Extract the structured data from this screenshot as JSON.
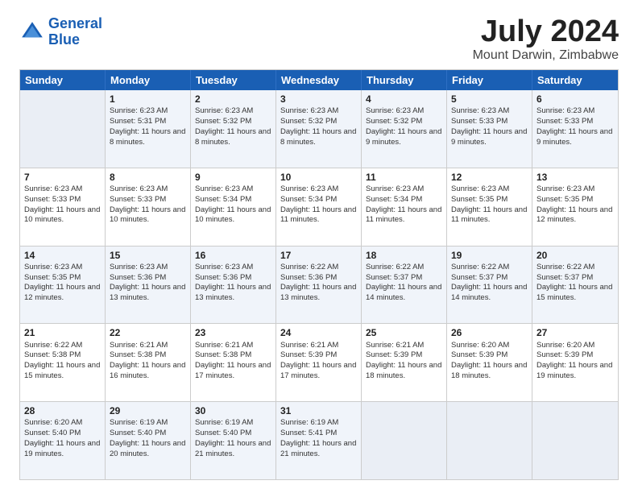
{
  "logo": {
    "line1": "General",
    "line2": "Blue"
  },
  "title": "July 2024",
  "location": "Mount Darwin, Zimbabwe",
  "header_days": [
    "Sunday",
    "Monday",
    "Tuesday",
    "Wednesday",
    "Thursday",
    "Friday",
    "Saturday"
  ],
  "weeks": [
    [
      {
        "day": "",
        "sunrise": "",
        "sunset": "",
        "daylight": ""
      },
      {
        "day": "1",
        "sunrise": "Sunrise: 6:23 AM",
        "sunset": "Sunset: 5:31 PM",
        "daylight": "Daylight: 11 hours and 8 minutes."
      },
      {
        "day": "2",
        "sunrise": "Sunrise: 6:23 AM",
        "sunset": "Sunset: 5:32 PM",
        "daylight": "Daylight: 11 hours and 8 minutes."
      },
      {
        "day": "3",
        "sunrise": "Sunrise: 6:23 AM",
        "sunset": "Sunset: 5:32 PM",
        "daylight": "Daylight: 11 hours and 8 minutes."
      },
      {
        "day": "4",
        "sunrise": "Sunrise: 6:23 AM",
        "sunset": "Sunset: 5:32 PM",
        "daylight": "Daylight: 11 hours and 9 minutes."
      },
      {
        "day": "5",
        "sunrise": "Sunrise: 6:23 AM",
        "sunset": "Sunset: 5:33 PM",
        "daylight": "Daylight: 11 hours and 9 minutes."
      },
      {
        "day": "6",
        "sunrise": "Sunrise: 6:23 AM",
        "sunset": "Sunset: 5:33 PM",
        "daylight": "Daylight: 11 hours and 9 minutes."
      }
    ],
    [
      {
        "day": "7",
        "sunrise": "Sunrise: 6:23 AM",
        "sunset": "Sunset: 5:33 PM",
        "daylight": "Daylight: 11 hours and 10 minutes."
      },
      {
        "day": "8",
        "sunrise": "Sunrise: 6:23 AM",
        "sunset": "Sunset: 5:33 PM",
        "daylight": "Daylight: 11 hours and 10 minutes."
      },
      {
        "day": "9",
        "sunrise": "Sunrise: 6:23 AM",
        "sunset": "Sunset: 5:34 PM",
        "daylight": "Daylight: 11 hours and 10 minutes."
      },
      {
        "day": "10",
        "sunrise": "Sunrise: 6:23 AM",
        "sunset": "Sunset: 5:34 PM",
        "daylight": "Daylight: 11 hours and 11 minutes."
      },
      {
        "day": "11",
        "sunrise": "Sunrise: 6:23 AM",
        "sunset": "Sunset: 5:34 PM",
        "daylight": "Daylight: 11 hours and 11 minutes."
      },
      {
        "day": "12",
        "sunrise": "Sunrise: 6:23 AM",
        "sunset": "Sunset: 5:35 PM",
        "daylight": "Daylight: 11 hours and 11 minutes."
      },
      {
        "day": "13",
        "sunrise": "Sunrise: 6:23 AM",
        "sunset": "Sunset: 5:35 PM",
        "daylight": "Daylight: 11 hours and 12 minutes."
      }
    ],
    [
      {
        "day": "14",
        "sunrise": "Sunrise: 6:23 AM",
        "sunset": "Sunset: 5:35 PM",
        "daylight": "Daylight: 11 hours and 12 minutes."
      },
      {
        "day": "15",
        "sunrise": "Sunrise: 6:23 AM",
        "sunset": "Sunset: 5:36 PM",
        "daylight": "Daylight: 11 hours and 13 minutes."
      },
      {
        "day": "16",
        "sunrise": "Sunrise: 6:23 AM",
        "sunset": "Sunset: 5:36 PM",
        "daylight": "Daylight: 11 hours and 13 minutes."
      },
      {
        "day": "17",
        "sunrise": "Sunrise: 6:22 AM",
        "sunset": "Sunset: 5:36 PM",
        "daylight": "Daylight: 11 hours and 13 minutes."
      },
      {
        "day": "18",
        "sunrise": "Sunrise: 6:22 AM",
        "sunset": "Sunset: 5:37 PM",
        "daylight": "Daylight: 11 hours and 14 minutes."
      },
      {
        "day": "19",
        "sunrise": "Sunrise: 6:22 AM",
        "sunset": "Sunset: 5:37 PM",
        "daylight": "Daylight: 11 hours and 14 minutes."
      },
      {
        "day": "20",
        "sunrise": "Sunrise: 6:22 AM",
        "sunset": "Sunset: 5:37 PM",
        "daylight": "Daylight: 11 hours and 15 minutes."
      }
    ],
    [
      {
        "day": "21",
        "sunrise": "Sunrise: 6:22 AM",
        "sunset": "Sunset: 5:38 PM",
        "daylight": "Daylight: 11 hours and 15 minutes."
      },
      {
        "day": "22",
        "sunrise": "Sunrise: 6:21 AM",
        "sunset": "Sunset: 5:38 PM",
        "daylight": "Daylight: 11 hours and 16 minutes."
      },
      {
        "day": "23",
        "sunrise": "Sunrise: 6:21 AM",
        "sunset": "Sunset: 5:38 PM",
        "daylight": "Daylight: 11 hours and 17 minutes."
      },
      {
        "day": "24",
        "sunrise": "Sunrise: 6:21 AM",
        "sunset": "Sunset: 5:39 PM",
        "daylight": "Daylight: 11 hours and 17 minutes."
      },
      {
        "day": "25",
        "sunrise": "Sunrise: 6:21 AM",
        "sunset": "Sunset: 5:39 PM",
        "daylight": "Daylight: 11 hours and 18 minutes."
      },
      {
        "day": "26",
        "sunrise": "Sunrise: 6:20 AM",
        "sunset": "Sunset: 5:39 PM",
        "daylight": "Daylight: 11 hours and 18 minutes."
      },
      {
        "day": "27",
        "sunrise": "Sunrise: 6:20 AM",
        "sunset": "Sunset: 5:39 PM",
        "daylight": "Daylight: 11 hours and 19 minutes."
      }
    ],
    [
      {
        "day": "28",
        "sunrise": "Sunrise: 6:20 AM",
        "sunset": "Sunset: 5:40 PM",
        "daylight": "Daylight: 11 hours and 19 minutes."
      },
      {
        "day": "29",
        "sunrise": "Sunrise: 6:19 AM",
        "sunset": "Sunset: 5:40 PM",
        "daylight": "Daylight: 11 hours and 20 minutes."
      },
      {
        "day": "30",
        "sunrise": "Sunrise: 6:19 AM",
        "sunset": "Sunset: 5:40 PM",
        "daylight": "Daylight: 11 hours and 21 minutes."
      },
      {
        "day": "31",
        "sunrise": "Sunrise: 6:19 AM",
        "sunset": "Sunset: 5:41 PM",
        "daylight": "Daylight: 11 hours and 21 minutes."
      },
      {
        "day": "",
        "sunrise": "",
        "sunset": "",
        "daylight": ""
      },
      {
        "day": "",
        "sunrise": "",
        "sunset": "",
        "daylight": ""
      },
      {
        "day": "",
        "sunrise": "",
        "sunset": "",
        "daylight": ""
      }
    ]
  ]
}
